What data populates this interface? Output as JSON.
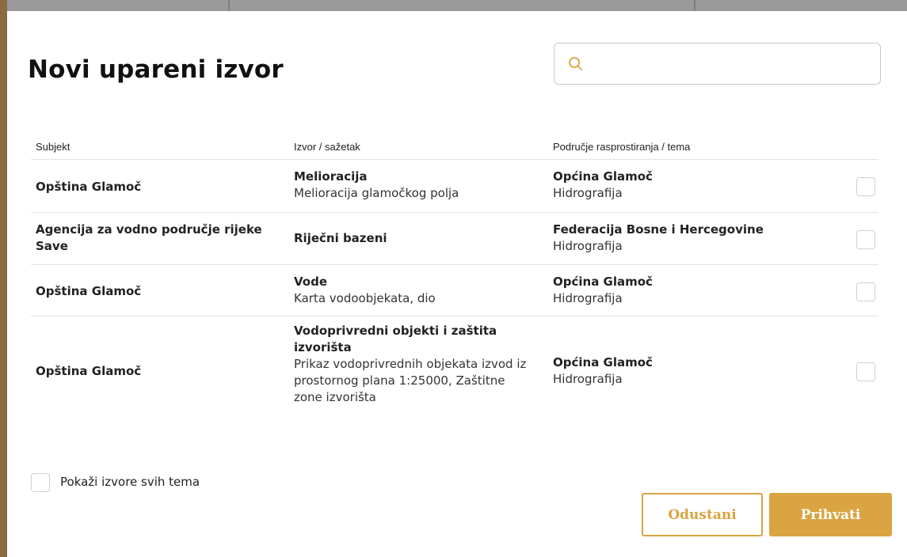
{
  "dialog": {
    "title": "Novi upareni izvor",
    "search": {
      "value": "",
      "placeholder": "",
      "icon": "search-icon"
    }
  },
  "table": {
    "headers": [
      "Subjekt",
      "Izvor / sažetak",
      "Područje rasprostiranja / tema"
    ],
    "rows": [
      {
        "subject": "Opština Glamoč",
        "source_title": "Melioracija",
        "source_summary": "Melioracija glamočkog polja",
        "area": "Općina Glamoč",
        "theme": "Hidrografija",
        "checked": false
      },
      {
        "subject": "Agencija za vodno područje rijeke Save",
        "source_title": "Riječni bazeni",
        "source_summary": "",
        "area": "Federacija Bosne i Hercegovine",
        "theme": "Hidrografija",
        "checked": false
      },
      {
        "subject": "Opština Glamoč",
        "source_title": "Vode",
        "source_summary": "Karta vodoobjekata, dio",
        "area": "Općina Glamoč",
        "theme": "Hidrografija",
        "checked": false
      },
      {
        "subject": "Opština Glamoč",
        "source_title": "Vodoprivredni objekti i zaštita izvorišta",
        "source_summary": "Prikaz vodoprivrednih objekata izvod iz prostornog plana 1:25000, Zaštitne zone izvorišta",
        "area": "Općina Glamoč",
        "theme": "Hidrografija",
        "checked": false
      }
    ]
  },
  "show_all_label": "Pokaži izvore svih tema",
  "buttons": {
    "cancel": "Odustani",
    "accept": "Prihvati"
  },
  "colors": {
    "accent": "#d9a441",
    "backdrop_left": "#8a6a3e",
    "backdrop_top": "#9a9a9a"
  }
}
